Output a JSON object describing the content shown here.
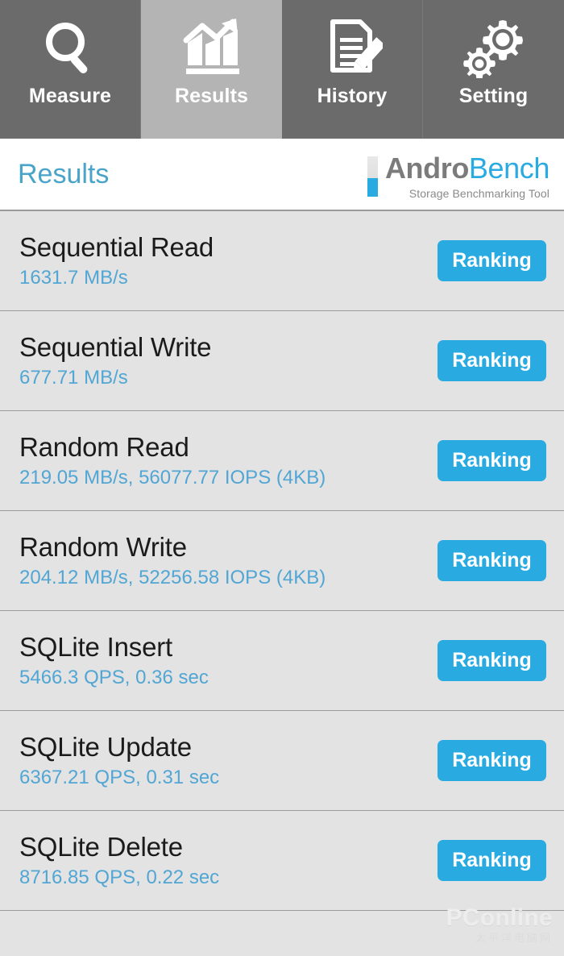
{
  "nav": {
    "tabs": [
      {
        "label": "Measure",
        "icon": "magnifier-icon",
        "active": false
      },
      {
        "label": "Results",
        "icon": "bar-chart-trend-icon",
        "active": true
      },
      {
        "label": "History",
        "icon": "document-pencil-icon",
        "active": false
      },
      {
        "label": "Setting",
        "icon": "gears-icon",
        "active": false
      }
    ]
  },
  "header": {
    "title": "Results",
    "logo": {
      "word_primary": "Andro",
      "word_secondary": "Bench",
      "tagline": "Storage Benchmarking Tool"
    }
  },
  "results": {
    "ranking_label": "Ranking",
    "rows": [
      {
        "name": "Sequential Read",
        "value": "1631.7 MB/s"
      },
      {
        "name": "Sequential Write",
        "value": "677.71 MB/s"
      },
      {
        "name": "Random Read",
        "value": "219.05 MB/s, 56077.77 IOPS (4KB)"
      },
      {
        "name": "Random Write",
        "value": "204.12 MB/s, 52256.58 IOPS (4KB)"
      },
      {
        "name": "SQLite Insert",
        "value": "5466.3 QPS, 0.36 sec"
      },
      {
        "name": "SQLite Update",
        "value": "6367.21 QPS, 0.31 sec"
      },
      {
        "name": "SQLite Delete",
        "value": "8716.85 QPS, 0.22 sec"
      }
    ]
  },
  "watermark": {
    "main": "PConline",
    "sub": "太平洋电脑网"
  },
  "colors": {
    "accent_blue": "#29abe2",
    "value_blue": "#52a6d4",
    "title_blue": "#4aa3c8",
    "nav_inactive": "#6b6b6b",
    "nav_active": "#b4b4b4",
    "row_bg": "#e3e3e3",
    "divider": "#9a9a9a"
  }
}
